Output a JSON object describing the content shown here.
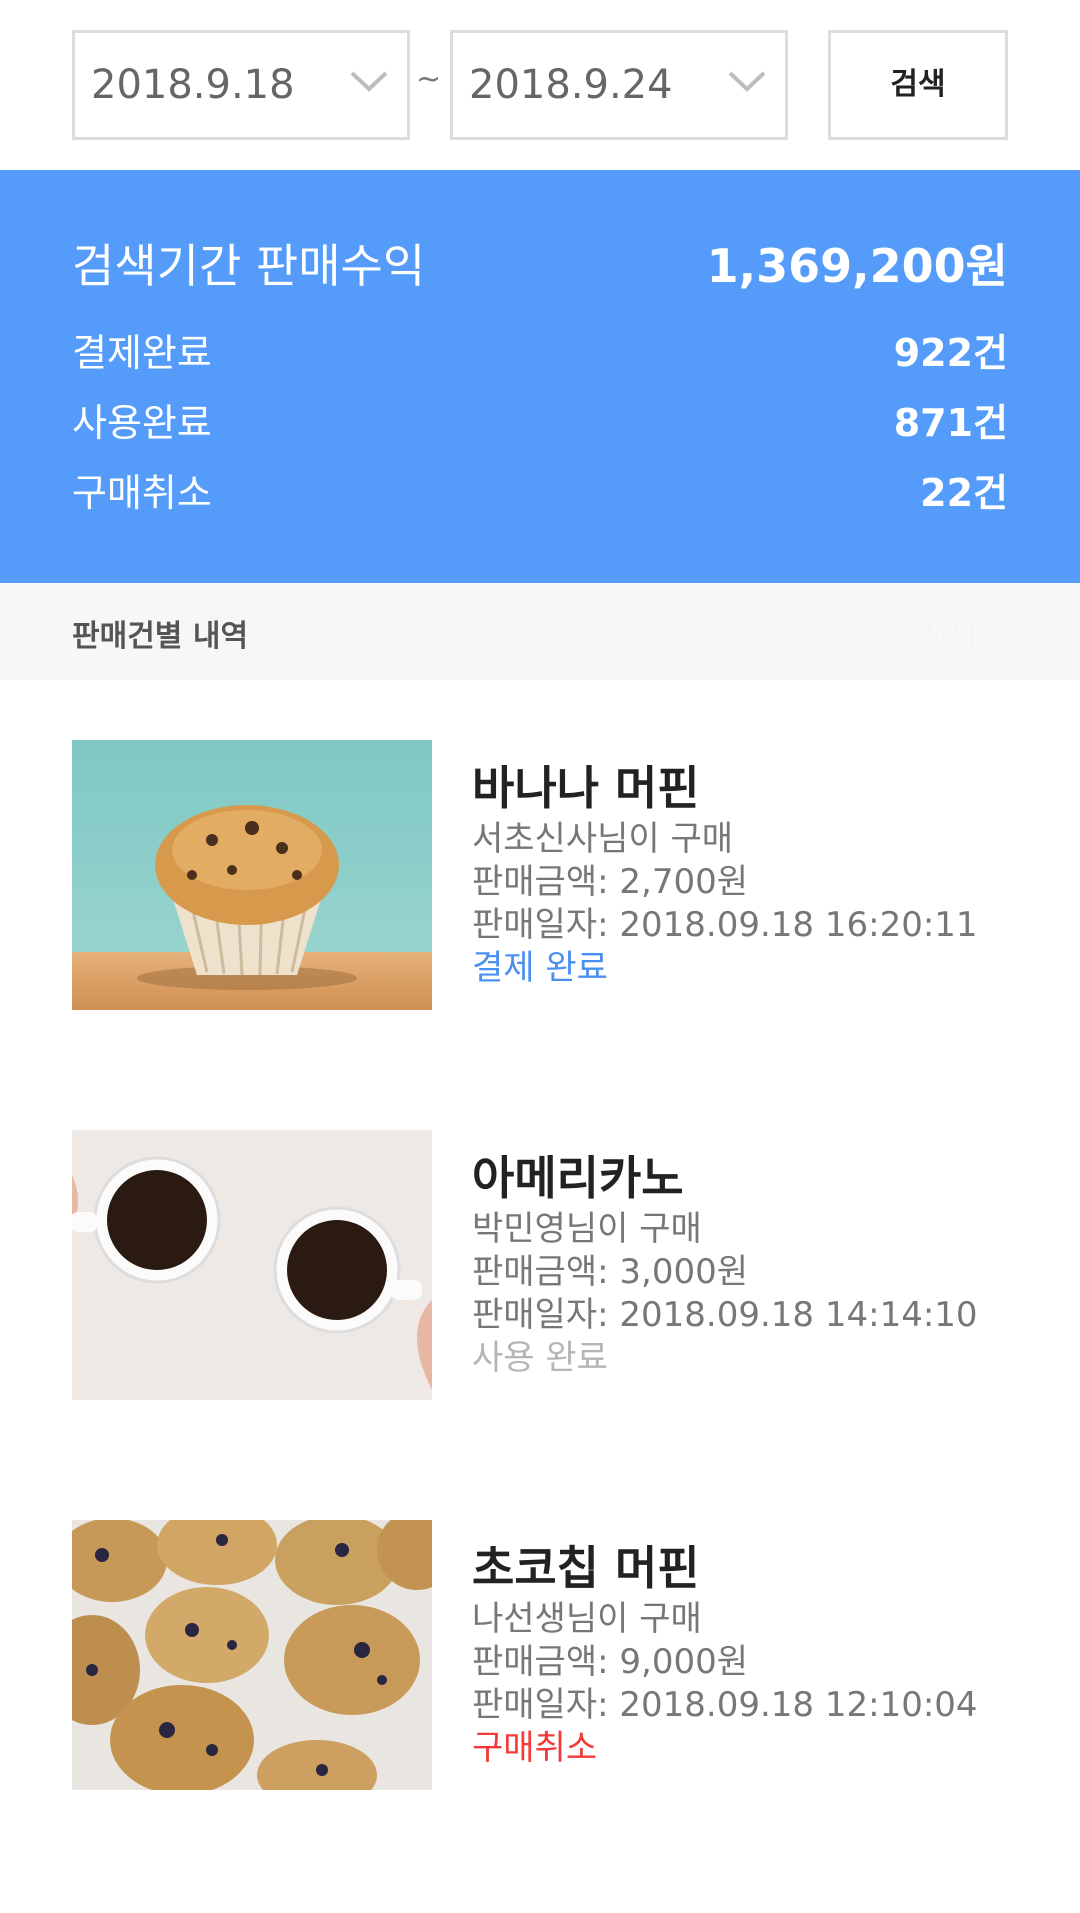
{
  "search": {
    "start_date": "2018.9.18",
    "end_date": "2018.9.24",
    "separator": "~",
    "button_label": "검색"
  },
  "summary": {
    "total_label": "검색기간 판매수익",
    "total_value": "1,369,200원",
    "paid_label": "결제완료",
    "paid_value": "922건",
    "used_label": "사용완료",
    "used_value": "871건",
    "cancel_label": "구매취소",
    "cancel_value": "22건"
  },
  "section": {
    "title": "판매건별 내역",
    "filter_label": "전체"
  },
  "sales": [
    {
      "name": "바나나 머핀",
      "buyer": "서초신사님이 구매",
      "amount": "판매금액: 2,700원",
      "date": "판매일자: 2018.09.18 16:20:11",
      "status": "결제 완료",
      "status_color": "#4a90f2",
      "image_icon": "muffin-photo"
    },
    {
      "name": "아메리카노",
      "buyer": "박민영님이 구매",
      "amount": "판매금액: 3,000원",
      "date": "판매일자: 2018.09.18 14:14:10",
      "status": "사용 완료",
      "status_color": "#b5b5b5",
      "image_icon": "coffee-photo"
    },
    {
      "name": "초코칩 머핀",
      "buyer": "나선생님이 구매",
      "amount": "판매금액: 9,000원",
      "date": "판매일자: 2018.09.18 12:10:04",
      "status": "구매취소",
      "status_color": "#f23a3a",
      "image_icon": "muffins-photo"
    }
  ],
  "colors": {
    "accent": "#559cfa",
    "section_bg": "#f7f7f7"
  }
}
